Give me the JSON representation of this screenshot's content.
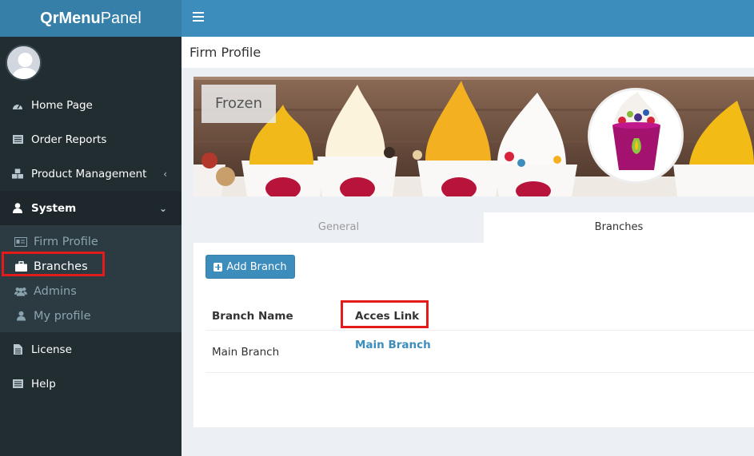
{
  "app": {
    "brand_bold": "QrMenu",
    "brand_regular": "Panel"
  },
  "sidebar": {
    "items": [
      {
        "label": "Home Page",
        "icon": "dashboard-icon"
      },
      {
        "label": "Order Reports",
        "icon": "list-icon"
      },
      {
        "label": "Product Management",
        "icon": "cubes-icon",
        "caret": "‹"
      },
      {
        "label": "System",
        "icon": "user-icon",
        "caret": "⌄"
      },
      {
        "label": "License",
        "icon": "file-icon"
      },
      {
        "label": "Help",
        "icon": "list-icon"
      }
    ],
    "system_submenu": [
      {
        "label": "Firm Profile",
        "icon": "id-card-icon"
      },
      {
        "label": "Branches",
        "icon": "briefcase-icon"
      },
      {
        "label": "Admins",
        "icon": "users-icon"
      },
      {
        "label": "My profile",
        "icon": "user-icon"
      }
    ]
  },
  "header": {
    "title": "Firm Profile"
  },
  "banner": {
    "firm_name": "Frozen"
  },
  "tabs": [
    {
      "label": "General"
    },
    {
      "label": "Branches"
    }
  ],
  "branches": {
    "add_button": "Add Branch",
    "columns": [
      "Branch Name",
      "Acces Link"
    ],
    "rows": [
      {
        "name": "Main Branch",
        "link": "Main Branch"
      }
    ]
  },
  "colors": {
    "accent": "#3c8dbc",
    "sidebar_bg": "#222d32",
    "highlight": "#e21b1b"
  }
}
